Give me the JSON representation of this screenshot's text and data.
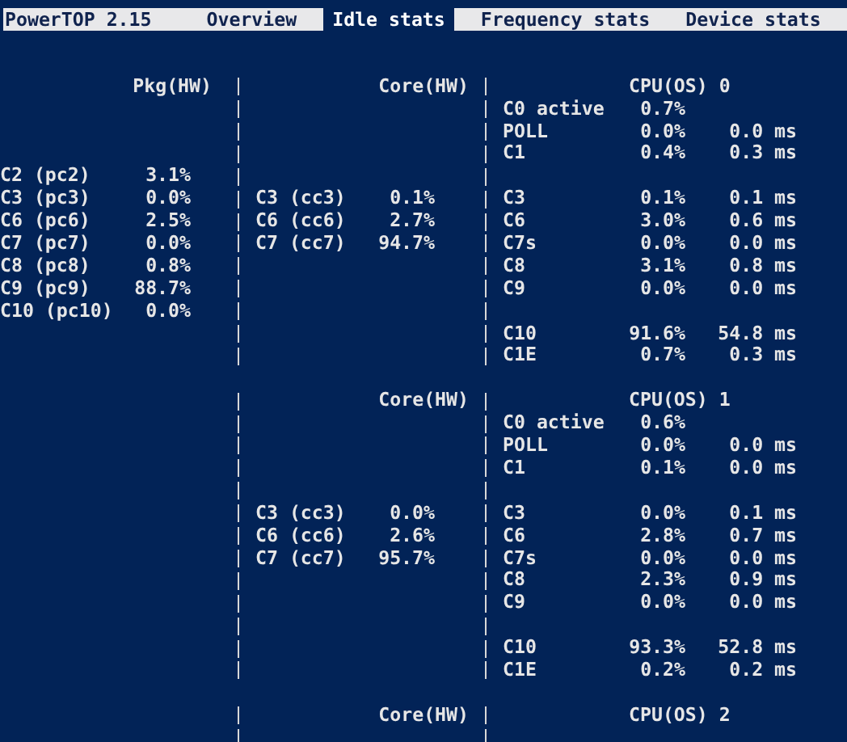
{
  "app_title": "PowerTOP 2.15",
  "tabs": [
    {
      "label": "Overview",
      "selected": false
    },
    {
      "label": "Idle stats",
      "selected": true
    },
    {
      "label": "Frequency stats",
      "selected": false
    },
    {
      "label": "Device stats",
      "selected": false
    }
  ],
  "blocks": [
    {
      "pkg": {
        "header": "Pkg(HW)",
        "rows": [
          {
            "kind": "gap"
          },
          {
            "kind": "gap"
          },
          {
            "kind": "gap"
          },
          {
            "kind": "state",
            "label": "C2 (pc2)",
            "value": "3.1%"
          },
          {
            "kind": "state",
            "label": "C3 (pc3)",
            "value": "0.0%"
          },
          {
            "kind": "state",
            "label": "C6 (pc6)",
            "value": "2.5%"
          },
          {
            "kind": "state",
            "label": "C7 (pc7)",
            "value": "0.0%"
          },
          {
            "kind": "state",
            "label": "C8 (pc8)",
            "value": "0.8%"
          },
          {
            "kind": "state",
            "label": "C9 (pc9)",
            "value": "88.7%"
          },
          {
            "kind": "state",
            "label": "C10 (pc10)",
            "value": "0.0%"
          }
        ]
      },
      "core": {
        "header": "Core(HW)",
        "rows": [
          {
            "kind": "gap"
          },
          {
            "kind": "gap"
          },
          {
            "kind": "gap"
          },
          {
            "kind": "gap"
          },
          {
            "kind": "state",
            "label": "C3 (cc3)",
            "value": "0.1%"
          },
          {
            "kind": "state",
            "label": "C6 (cc6)",
            "value": "2.7%"
          },
          {
            "kind": "state",
            "label": "C7 (cc7)",
            "value": "94.7%"
          }
        ]
      },
      "cpu": {
        "header": "CPU(OS) 0",
        "rows": [
          {
            "kind": "state",
            "label": "C0 active",
            "percent": "0.7%"
          },
          {
            "kind": "state",
            "label": "POLL",
            "percent": "0.0%",
            "time": "0.0 ms"
          },
          {
            "kind": "state",
            "label": "C1",
            "percent": "0.4%",
            "time": "0.3 ms"
          },
          {
            "kind": "gap"
          },
          {
            "kind": "state",
            "label": "C3",
            "percent": "0.1%",
            "time": "0.1 ms"
          },
          {
            "kind": "state",
            "label": "C6",
            "percent": "3.0%",
            "time": "0.6 ms"
          },
          {
            "kind": "state",
            "label": "C7s",
            "percent": "0.0%",
            "time": "0.0 ms"
          },
          {
            "kind": "state",
            "label": "C8",
            "percent": "3.1%",
            "time": "0.8 ms"
          },
          {
            "kind": "state",
            "label": "C9",
            "percent": "0.0%",
            "time": "0.0 ms"
          },
          {
            "kind": "gap"
          },
          {
            "kind": "state",
            "label": "C10",
            "percent": "91.6%",
            "time": "54.8 ms"
          },
          {
            "kind": "state",
            "label": "C1E",
            "percent": "0.7%",
            "time": "0.3 ms"
          }
        ]
      }
    },
    {
      "core": {
        "header": "Core(HW)",
        "rows": [
          {
            "kind": "gap"
          },
          {
            "kind": "gap"
          },
          {
            "kind": "gap"
          },
          {
            "kind": "gap"
          },
          {
            "kind": "state",
            "label": "C3 (cc3)",
            "value": "0.0%"
          },
          {
            "kind": "state",
            "label": "C6 (cc6)",
            "value": "2.6%"
          },
          {
            "kind": "state",
            "label": "C7 (cc7)",
            "value": "95.7%"
          }
        ]
      },
      "cpu": {
        "header": "CPU(OS) 1",
        "rows": [
          {
            "kind": "state",
            "label": "C0 active",
            "percent": "0.6%"
          },
          {
            "kind": "state",
            "label": "POLL",
            "percent": "0.0%",
            "time": "0.0 ms"
          },
          {
            "kind": "state",
            "label": "C1",
            "percent": "0.1%",
            "time": "0.0 ms"
          },
          {
            "kind": "gap"
          },
          {
            "kind": "state",
            "label": "C3",
            "percent": "0.0%",
            "time": "0.1 ms"
          },
          {
            "kind": "state",
            "label": "C6",
            "percent": "2.8%",
            "time": "0.7 ms"
          },
          {
            "kind": "state",
            "label": "C7s",
            "percent": "0.0%",
            "time": "0.0 ms"
          },
          {
            "kind": "state",
            "label": "C8",
            "percent": "2.3%",
            "time": "0.9 ms"
          },
          {
            "kind": "state",
            "label": "C9",
            "percent": "0.0%",
            "time": "0.0 ms"
          },
          {
            "kind": "gap"
          },
          {
            "kind": "state",
            "label": "C10",
            "percent": "93.3%",
            "time": "52.8 ms"
          },
          {
            "kind": "state",
            "label": "C1E",
            "percent": "0.2%",
            "time": "0.2 ms"
          }
        ]
      }
    },
    {
      "core": {
        "header": "Core(HW)"
      },
      "cpu": {
        "header": "CPU(OS) 2"
      }
    }
  ]
}
